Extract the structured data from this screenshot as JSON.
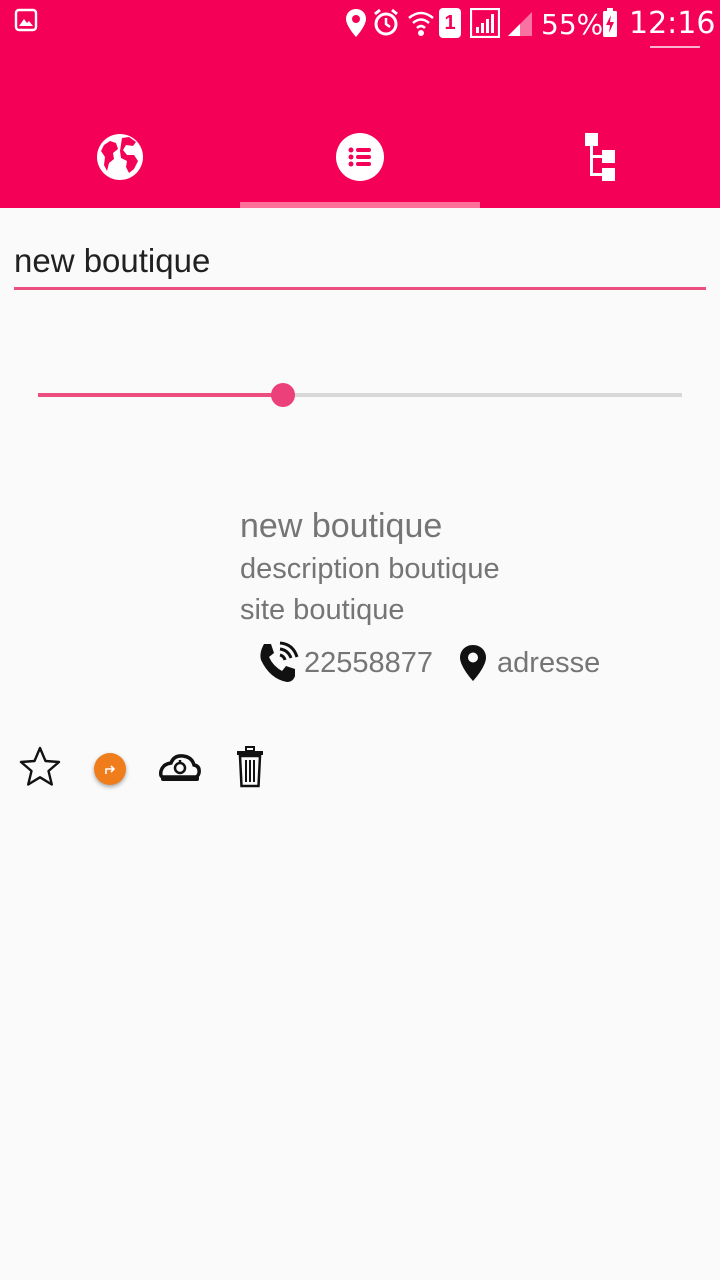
{
  "status_bar": {
    "battery_percent": "55%",
    "time": "12:16",
    "sim_slot": "1",
    "icons": [
      "gallery-icon",
      "location-icon",
      "alarm-icon",
      "wifi-icon",
      "sim-1-icon",
      "signal-icon",
      "signal-2-icon",
      "battery-charging-icon"
    ]
  },
  "tabs": [
    {
      "icon": "globe-icon",
      "selected": false
    },
    {
      "icon": "list-icon",
      "selected": true
    },
    {
      "icon": "hierarchy-icon",
      "selected": false
    }
  ],
  "form": {
    "name_value": "new boutique"
  },
  "slider": {
    "value_fraction": 0.38
  },
  "shop": {
    "title": "new boutique",
    "description": "description boutique",
    "site": "site boutique",
    "phone": "22558877",
    "address": "adresse"
  },
  "actions": [
    "star-icon",
    "share-icon",
    "cloud-sync-icon",
    "trash-icon"
  ],
  "colors": {
    "accent": "#f50057",
    "accent_light": "#ec407a",
    "share": "#ef7d1c",
    "text_secondary": "#757575"
  }
}
